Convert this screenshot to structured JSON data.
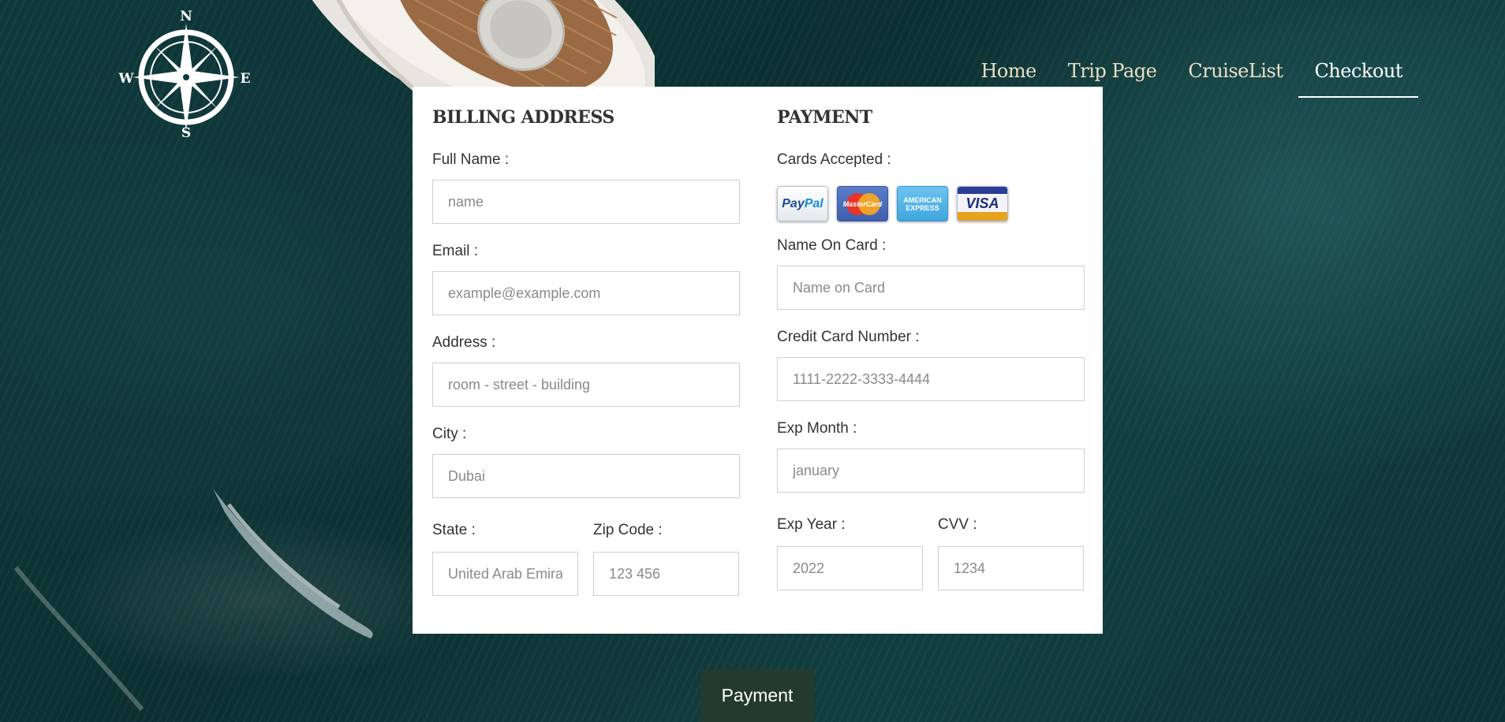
{
  "nav": {
    "items": [
      {
        "label": "Home"
      },
      {
        "label": "Trip Page"
      },
      {
        "label": "CruiseList"
      },
      {
        "label": "Checkout"
      }
    ],
    "active": "Checkout"
  },
  "logo": {
    "icon": "compass-rose-icon",
    "n": "N",
    "s": "S",
    "e": "E",
    "w": "W"
  },
  "billing": {
    "title": "BILLING ADDRESS",
    "full_name": {
      "label": "Full Name :",
      "placeholder": "name"
    },
    "email": {
      "label": "Email :",
      "placeholder": "example@example.com"
    },
    "address": {
      "label": "Address :",
      "placeholder": "room - street - building"
    },
    "city": {
      "label": "City :",
      "placeholder": "Dubai"
    },
    "state": {
      "label": "State :",
      "placeholder": "United Arab Emirates"
    },
    "zip": {
      "label": "Zip Code :",
      "placeholder": "123 456"
    }
  },
  "payment": {
    "title": "PAYMENT",
    "cards_label": "Cards Accepted :",
    "cards": {
      "paypal_a": "Pay",
      "paypal_b": "Pal",
      "mastercard": "MasterCard",
      "amex_a": "AMERICAN",
      "amex_b": "EXPRESS",
      "visa": "VISA"
    },
    "name_on_card": {
      "label": "Name On Card :",
      "placeholder": "Name on Card"
    },
    "card_number": {
      "label": "Credit Card Number :",
      "placeholder": "1111-2222-3333-4444"
    },
    "exp_month": {
      "label": "Exp Month :",
      "placeholder": "january"
    },
    "exp_year": {
      "label": "Exp Year :",
      "placeholder": "2022"
    },
    "cvv": {
      "label": "CVV :",
      "placeholder": "1234"
    }
  },
  "submit": {
    "label": "Payment"
  },
  "colors": {
    "ocean": "#0f3a3c",
    "nav_text": "#e9dfc4",
    "button": "#243a2f"
  }
}
